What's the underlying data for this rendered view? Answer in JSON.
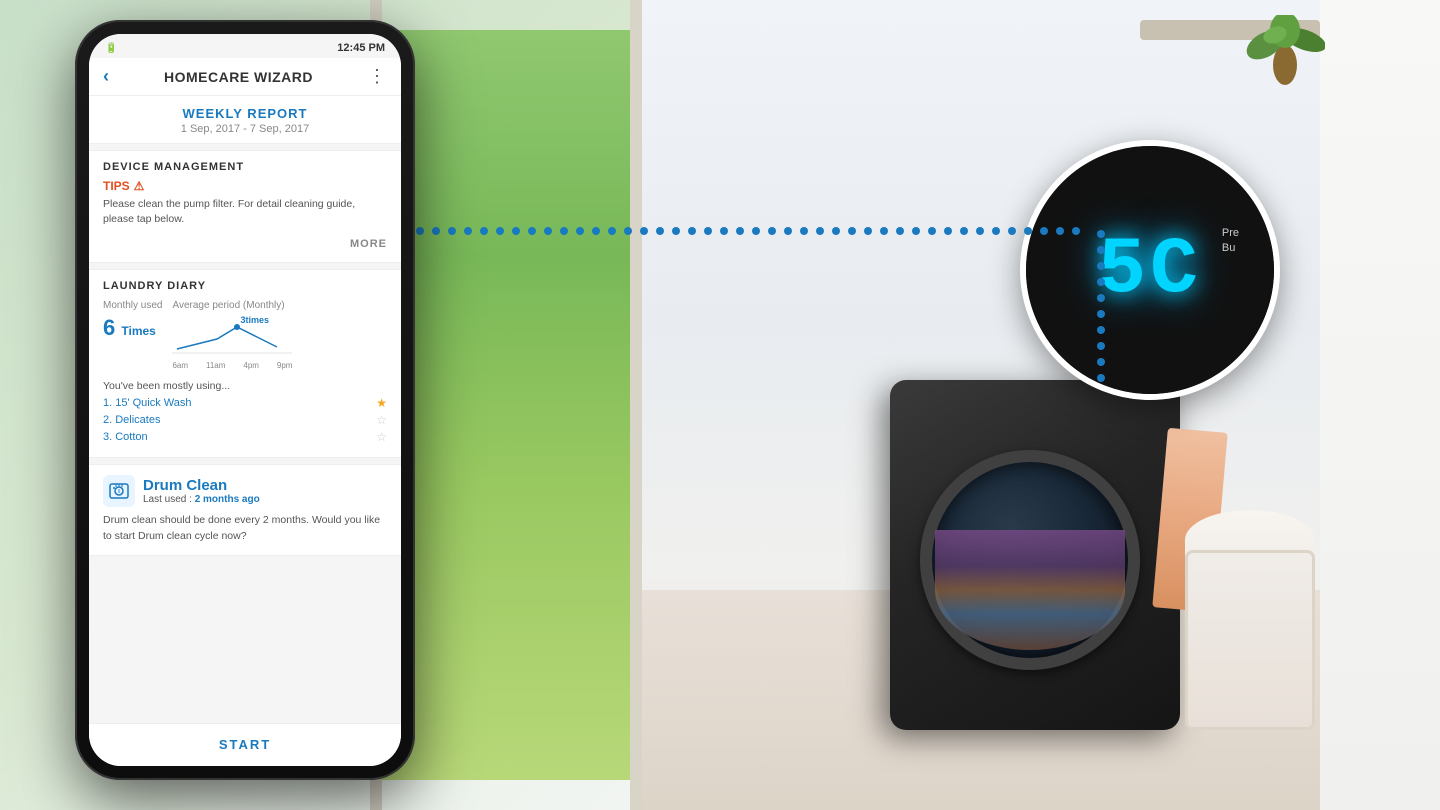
{
  "background": {
    "color_left": "#c8dfc8",
    "color_right": "#f0f4f8"
  },
  "display": {
    "digits": "5C",
    "label_line1": "Pre",
    "label_line2": "Bu"
  },
  "dotted_line": {
    "count": 30,
    "color": "#1a7abf"
  },
  "phone": {
    "time": "12:45 PM",
    "battery_icon": "🔋",
    "header": {
      "back_label": "‹",
      "title": "HOMECARE WIZARD",
      "menu_label": "⋮"
    },
    "weekly_report": {
      "title": "WEEKLY REPORT",
      "date_range": "1 Sep, 2017 - 7 Sep, 2017"
    },
    "device_management": {
      "section_title": "DEVICE MANAGEMENT",
      "tips_label": "TIPS",
      "tips_warning": "⚠",
      "tips_text": "Please clean the pump filter. For detail cleaning guide, please tap below.",
      "more_label": "MORE"
    },
    "laundry_diary": {
      "section_title": "LAUNDRY DIARY",
      "monthly_label": "Monthly used",
      "monthly_count": "6",
      "monthly_unit": "Times",
      "avg_label": "Average period (Monthly)",
      "chart_peak": "3times",
      "chart_x_labels": [
        "6am",
        "11am",
        "4pm",
        "9pm"
      ],
      "mostly_using_label": "You've been mostly using...",
      "wash_items": [
        {
          "rank": "1.",
          "name": "15' Quick Wash",
          "star": "filled"
        },
        {
          "rank": "2.",
          "name": "Delicates",
          "star": "empty"
        },
        {
          "rank": "3.",
          "name": "Cotton",
          "star": "empty"
        }
      ]
    },
    "drum_clean": {
      "section_title": "Drum Clean",
      "last_used_label": "Last used : ",
      "last_used_time": "2 months ago",
      "description": "Drum clean should be done every 2 months. Would you like to start Drum clean cycle now?"
    },
    "start_button": {
      "label": "START"
    }
  }
}
